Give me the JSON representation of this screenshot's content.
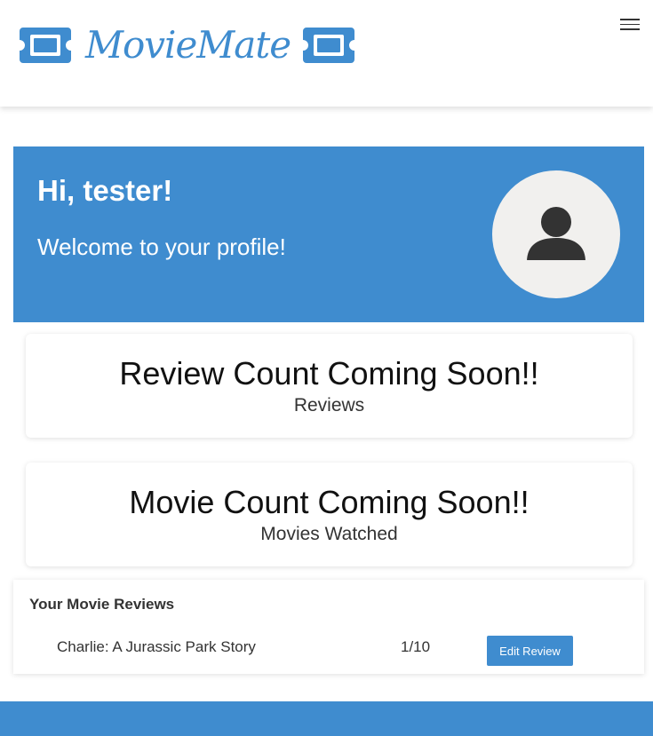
{
  "header": {
    "logo_text": "MovieMate",
    "menu_icon": "hamburger-icon",
    "brand_color": "#3f8ccf"
  },
  "hero": {
    "greeting": "Hi, tester!",
    "welcome": "Welcome to your profile!",
    "avatar_icon": "user-icon",
    "background_color": "#3f8ccf"
  },
  "stats": {
    "reviews": {
      "value": "Review Count Coming Soon!!",
      "label": "Reviews"
    },
    "movies": {
      "value": "Movie Count Coming Soon!!",
      "label": "Movies Watched"
    }
  },
  "reviews": {
    "title": "Your Movie Reviews",
    "items": [
      {
        "movie": "Charlie: A Jurassic Park Story",
        "rating": "1/10",
        "button_label": "Edit Review"
      }
    ]
  }
}
